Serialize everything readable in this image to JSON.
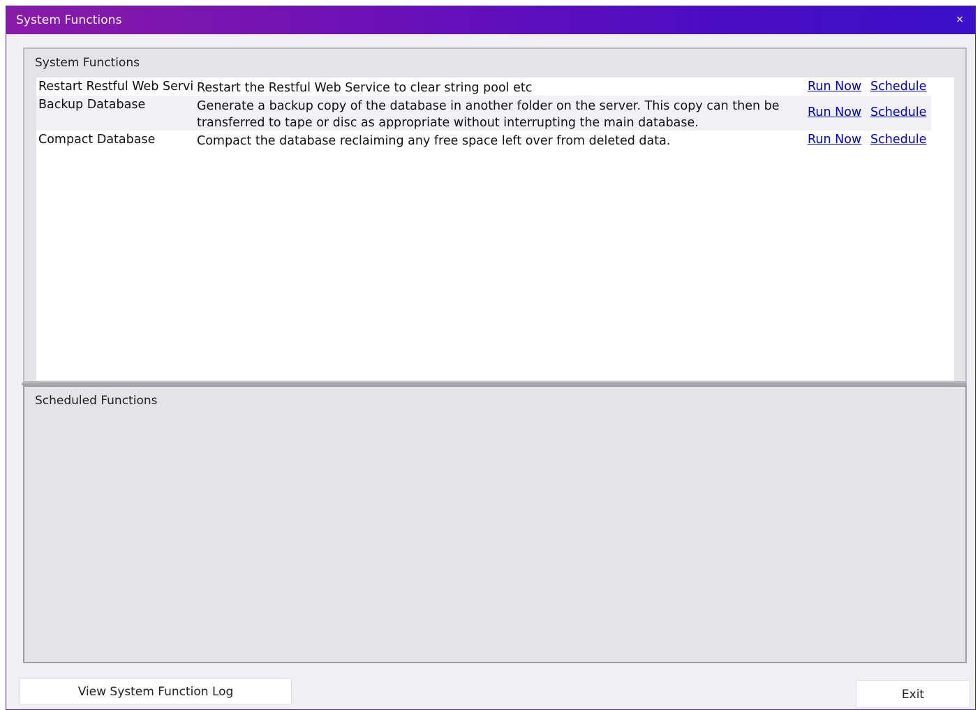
{
  "window": {
    "title": "System Functions",
    "close_label": "×"
  },
  "functions_panel": {
    "label": "System Functions",
    "rows": [
      {
        "name": "Restart Restful Web Service",
        "description": "Restart the Restful Web Service to clear string pool etc",
        "run_label": "Run Now",
        "schedule_label": "Schedule"
      },
      {
        "name": "Backup Database",
        "description": "Generate a backup copy of the database in another folder on the server. This copy can then be transferred to tape or disc as appropriate without interrupting the main database.",
        "run_label": "Run Now",
        "schedule_label": "Schedule"
      },
      {
        "name": "Compact Database",
        "description": "Compact the database reclaiming any free space left over from deleted data.",
        "run_label": "Run Now",
        "schedule_label": "Schedule"
      }
    ]
  },
  "scheduled_panel": {
    "label": "Scheduled Functions"
  },
  "buttons": {
    "view_log": "View System Function Log",
    "exit": "Exit"
  },
  "colors": {
    "titlebar_start": "#8a1aa8",
    "titlebar_end": "#3a10c8",
    "link": "#0000cc"
  }
}
